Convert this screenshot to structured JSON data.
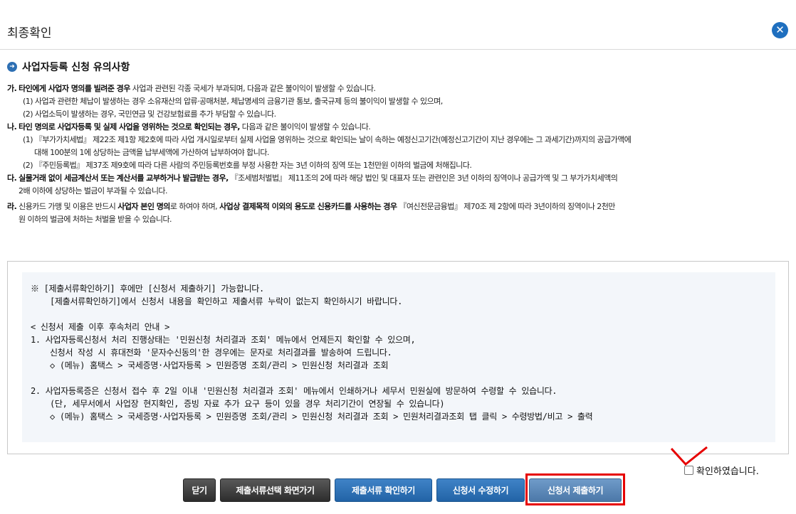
{
  "header": {
    "title": "최종확인",
    "close_icon": "close-icon"
  },
  "section": {
    "title": "사업자등록 신청 유의사항",
    "icon": "arrow-right-circle-icon"
  },
  "notes": {
    "ga": {
      "marker": "가.",
      "bold": "타인에게 사업자 명의를 빌려준 경우",
      "rest": " 사업과 관련된 각종 국세가 부과되며, 다음과 같은 불이익이 발생할 수 있습니다.",
      "sub1": "(1) 사업과 관련한 체납이 발생하는 경우 소유재산의 압류·공매처분, 체납명세의 금융기관 통보, 출국규제 등의 불이익이 발생할 수 있으며,",
      "sub2": "(2) 사업소득이 발생하는 경우, 국민연금 및 건강보험료를 추가 부담할 수 있습니다."
    },
    "na": {
      "marker": "나.",
      "bold": "타인 명의로 사업자등록 및 실제 사업을 영위하는 것으로 확인되는 경우,",
      "rest": " 다음과 같은 불이익이 발생할 수 있습니다.",
      "sub1": "(1) 『부가가치세법』 제22조 제1항 제2호에 따라 사업 개시일로부터 실제 사업을 영위하는 것으로 확인되는 날이 속하는 예정신고기간(예정신고기간이 지난 경우에는 그 과세기간)까지의 공급가액에",
      "sub1b": "대해 100분의 1에 상당하는 금액을 납부세액에 가산하여 납부하여야 합니다.",
      "sub2": "(2) 『주민등록법』 제37조 제9호에 따라 다른 사람의 주민등록번호를 부정 사용한 자는 3년 이하의 징역 또는 1천만원 이하의 벌금에 처해집니다."
    },
    "da": {
      "marker": "다.",
      "bold": "실물거래 없이 세금계산서 또는 계산서를 교부하거나 발급받는 경우,",
      "rest": " 『조세범처벌법』 제11조의 2에 따라 해당 법인 및 대표자 또는 관련인은 3년 이하의 징역이나 공급가액 및 그 부가가치세액의",
      "cont": "2배 이하에 상당하는 벌금이 부과될 수 있습니다."
    },
    "ra": {
      "marker": "라.",
      "text1": " 신용카드 가맹 및 이용은 반드시 ",
      "bold1": "사업자 본인 명의",
      "text2": "로 하여야 하며, ",
      "bold2": "사업상 결제목적 이외의 용도로 신용카드를 사용하는 경우",
      "text3": " 『여신전문금융법』 제70조 제 2항에 따라 3년이하의 징역이나 2천만",
      "cont": "원 이하의 벌금에 처하는 처벌을 받을 수 있습니다."
    }
  },
  "info": {
    "line1": "※  [제출서류확인하기] 후에만 [신청서 제출하기] 가능합니다.",
    "line2": "[제출서류확인하기]에서 신청서 내용을 확인하고 제출서류 누락이 없는지 확인하시기 바랍니다.",
    "line3": "< 신청서 제출 이후 후속처리 안내 >",
    "line4": "1.  사업자등록신청서 처리 진행상태는 '민원신청 처리결과 조회' 메뉴에서 언제든지 확인할 수 있으며,",
    "line5": "신청서 작성 시 휴대전화 '문자수신동의'한 경우에는 문자로 처리결과를 발송하여 드립니다.",
    "line6": "◇ (메뉴) 홈택스 > 국세증명·사업자등록 > 민원증명 조회/관리 > 민원신청 처리결과 조회",
    "line7": "2.  사업자등록증은 신청서 접수 후 2일 이내 '민원신청 처리결과 조회' 메뉴에서 인쇄하거나 세무서 민원실에 방문하여 수령할 수 있습니다.",
    "line8": "(단, 세무서에서 사업장 현지확인, 증빙 자료 추가 요구 등이 있을 경우 처리기간이 연장될 수 있습니다)",
    "line9": "◇ (메뉴) 홈택스 > 국세증명·사업자등록 > 민원증명 조회/관리 > 민원신청 처리결과 조회 > 민원처리결과조회 탭 클릭 > 수령방법/비고 > 출력"
  },
  "confirm": {
    "label": "확인하였습니다.",
    "checked": false
  },
  "buttons": {
    "close": "닫기",
    "select_docs": "제출서류선택 화면가기",
    "check_docs": "제출서류 확인하기",
    "edit_app": "신청서 수정하기",
    "submit_app": "신청서 제출하기"
  },
  "colors": {
    "close_button": "#1f6fbf",
    "highlight": "#e60000",
    "info_bg": "#f3f6fa"
  }
}
